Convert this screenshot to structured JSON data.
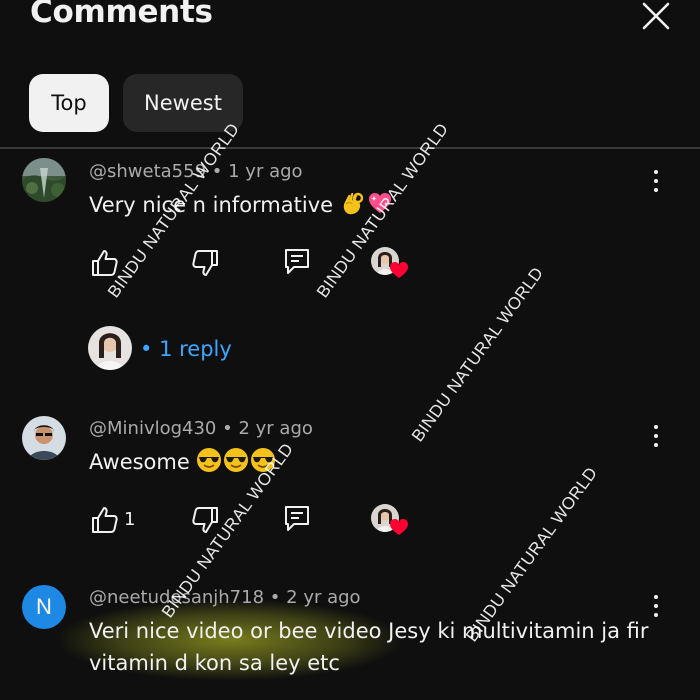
{
  "header": {
    "title": "Comments"
  },
  "sort": {
    "top_label": "Top",
    "newest_label": "Newest"
  },
  "comments": [
    {
      "author": "@shweta55",
      "author_tail": "9",
      "age": "1 yr ago",
      "text": "Very nice n informative",
      "emojis": [
        "ok-hand-emoji",
        "sparkling-heart-emoji"
      ],
      "likes": "",
      "replies_label": "1 reply"
    },
    {
      "author": "@Minivlog430",
      "age": "2 yr ago",
      "text": "Awesome",
      "emojis": [
        "sunglasses-emoji",
        "sunglasses-emoji",
        "sunglasses-emoji"
      ],
      "likes": "1"
    },
    {
      "author": "@neetudosanjh718",
      "age": "2 yr ago",
      "avatar_letter": "N",
      "text_line1": "Veri nice video or bee video Jesy ki multivitamin ja fir",
      "text_line2": "vitamin d kon sa ley etc"
    }
  ],
  "meta_separator": "•",
  "watermark": "BINDU NATURAL WORLD",
  "colors": {
    "background": "#0f0f0f",
    "link_blue": "#3ea6ff",
    "chip_active": "#f1f1f1",
    "chip_inactive": "#272727",
    "heart_red": "#ff0033",
    "highlight": "#cdd728",
    "avatar_n": "#1e88e5"
  }
}
